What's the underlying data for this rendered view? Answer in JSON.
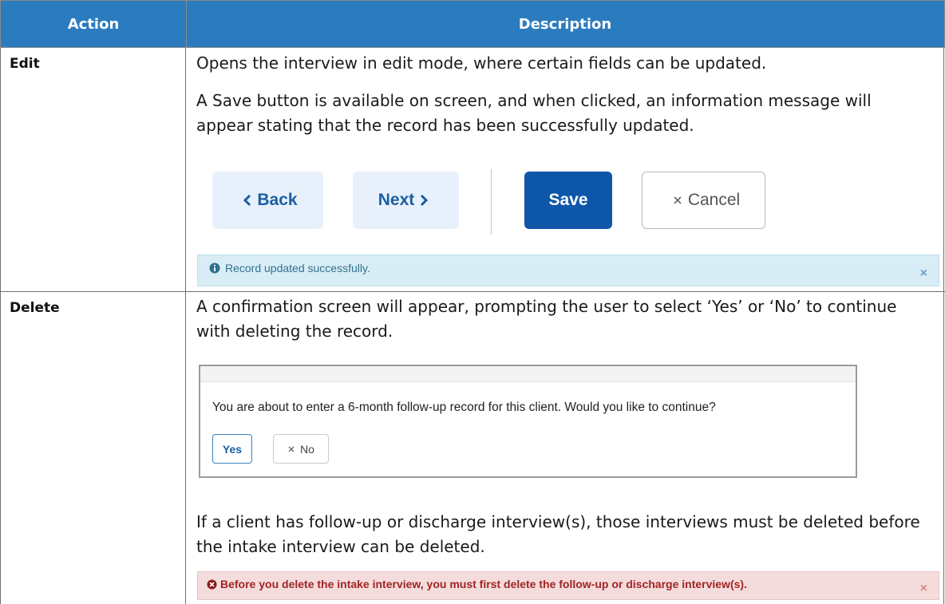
{
  "table": {
    "headers": {
      "action": "Action",
      "description": "Description"
    },
    "rows": [
      {
        "action": "Edit",
        "paragraphs": [
          "Opens the interview in edit mode, where certain fields can be updated.",
          "A Save button is available on screen, and when clicked, an information message will appear stating that the record has been successfully updated."
        ],
        "buttons": {
          "back": "Back",
          "next": "Next",
          "save": "Save",
          "cancel": "Cancel"
        },
        "alert": {
          "message": "Record updated successfully.",
          "close": "×"
        }
      },
      {
        "action": "Delete",
        "paragraphs": [
          "A confirmation screen will appear, prompting the user to select ‘Yes’ or ‘No’ to continue with deleting the record.",
          "If a client has follow-up or discharge interview(s), those interviews must be deleted before the intake interview can be deleted."
        ],
        "confirm": {
          "question": "You are about to enter a 6-month follow-up record for this client. Would you like to continue?",
          "yes": "Yes",
          "no": "No"
        },
        "alert": {
          "message": "Before you delete the intake interview, you must first delete the follow-up or discharge interview(s).",
          "close": "×"
        }
      }
    ]
  },
  "colors": {
    "header_bg": "#2b7bbf",
    "save_bg": "#0e57a8",
    "info_bg": "#d9edf6",
    "danger_bg": "#f4dcdc"
  }
}
